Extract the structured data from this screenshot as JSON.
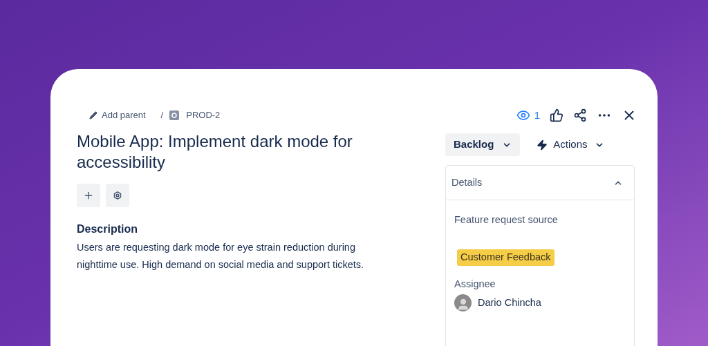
{
  "breadcrumb": {
    "add_parent": "Add parent",
    "separator": "/",
    "issue_key": "PROD-2"
  },
  "watchers": {
    "count": "1"
  },
  "title": "Mobile App: Implement dark mode for accessibility",
  "description": {
    "heading": "Description",
    "text": "Users are requesting dark mode for eye strain reduction during nighttime use. High demand on social media and support tickets."
  },
  "status": {
    "label": "Backlog"
  },
  "actions": {
    "label": "Actions"
  },
  "details": {
    "title": "Details",
    "expanded": true,
    "fields": [
      {
        "kind": "tag",
        "label": "Feature request source",
        "value": "Customer Feedback",
        "color": "#f5cd47"
      },
      {
        "kind": "user",
        "label": "Assignee",
        "value": "Dario Chincha"
      }
    ]
  }
}
